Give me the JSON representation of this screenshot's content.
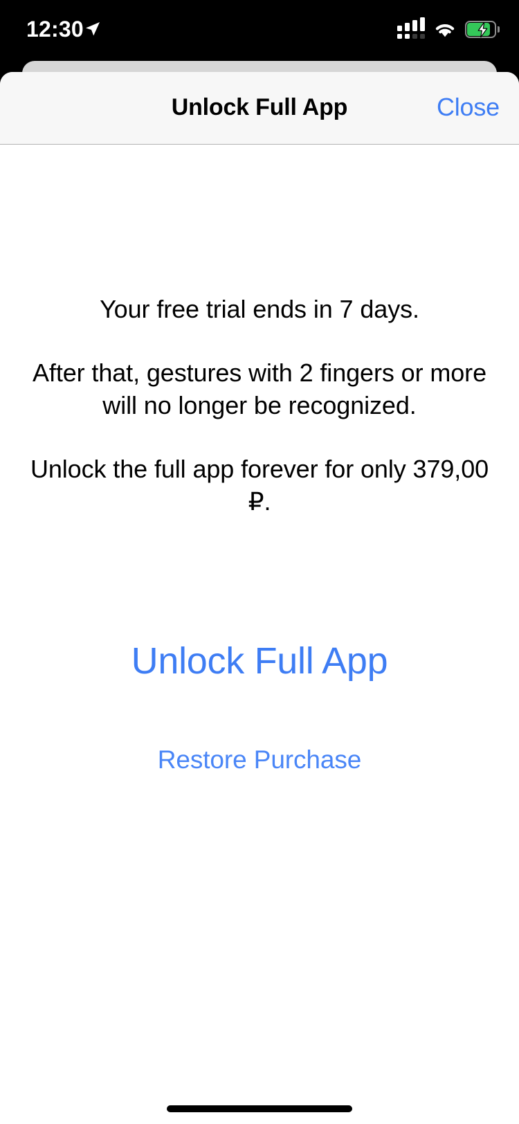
{
  "status_bar": {
    "time": "12:30",
    "location_icon": "location-arrow-icon",
    "cellular_icon": "cellular-signal-icon",
    "cellular_bars_filled": 4,
    "cellular_dots_filled": 2,
    "wifi_icon": "wifi-icon",
    "battery_icon": "battery-charging-icon",
    "battery_charging": true,
    "battery_fill_color": "#34C759"
  },
  "sheet": {
    "nav": {
      "title": "Unlock Full App",
      "close_label": "Close"
    },
    "body": {
      "trial_line": "Your free trial ends in 7 days.",
      "gesture_line": "After that, gestures with 2 fingers or more will no longer be recognized.",
      "price_line": "Unlock the full app forever for only 379,00 ₽.",
      "unlock_label": "Unlock Full App",
      "restore_label": "Restore Purchase"
    }
  },
  "colors": {
    "accent_blue": "#3E7DF4",
    "restore_blue": "#4A86F7",
    "navbar_bg": "#F7F7F7",
    "behind_card": "#D6D6D6",
    "sheet_bg": "#FFFFFF",
    "status_bar_bg": "#000000"
  },
  "home_indicator": "home-indicator"
}
